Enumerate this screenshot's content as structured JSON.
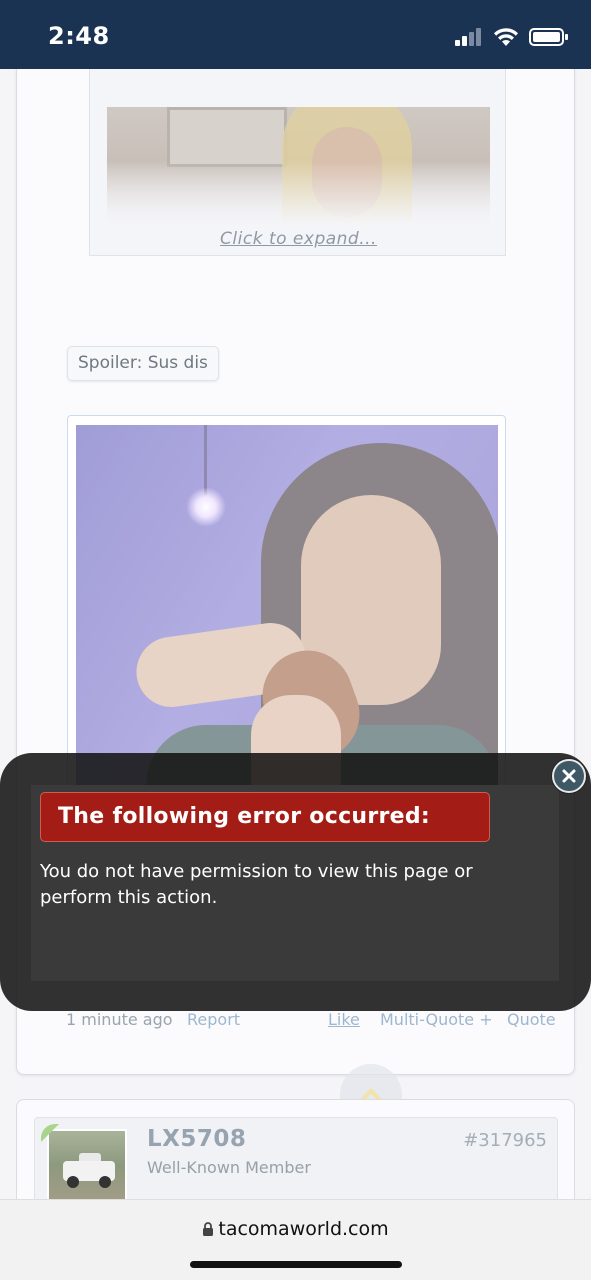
{
  "status_bar": {
    "time": "2:48"
  },
  "quote": {
    "expand_label": "Click to expand..."
  },
  "spoiler": {
    "button_label": "Spoiler: Sus dis"
  },
  "post_footer": {
    "timestamp": "1 minute ago",
    "report": "Report",
    "like": "Like",
    "multi_quote": "Multi-Quote +",
    "quote": "Quote"
  },
  "next_post": {
    "username": "LX5708",
    "user_title": "Well-Known Member",
    "post_number": "#317965"
  },
  "error_dialog": {
    "title": "The following error occurred:",
    "message": "You do not have permission to view this page or perform this action."
  },
  "browser": {
    "url": "tacomaworld.com"
  },
  "colors": {
    "status_bar_bg": "#1a3352",
    "error_header_bg": "#a31d16",
    "link": "#9fb6cf"
  }
}
